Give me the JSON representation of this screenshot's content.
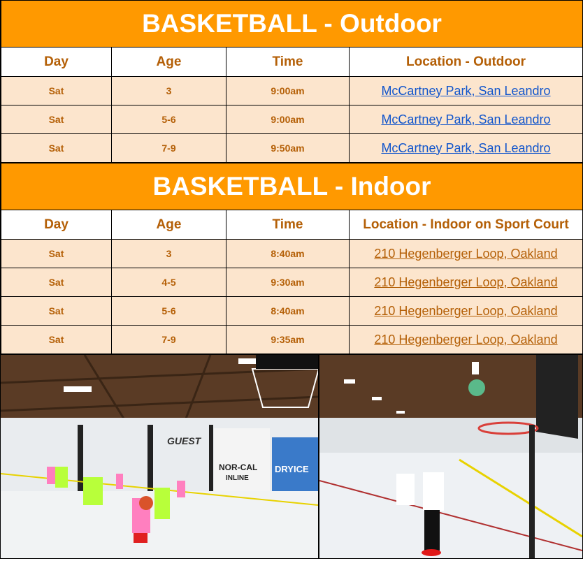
{
  "outdoor": {
    "title": "BASKETBALL - Outdoor",
    "headers": [
      "Day",
      "Age",
      "Time",
      "Location - Outdoor"
    ],
    "rows": [
      {
        "day": "Sat",
        "age": "3",
        "time": "9:00am",
        "location": "McCartney Park, San Leandro"
      },
      {
        "day": "Sat",
        "age": "5-6",
        "time": "9:00am",
        "location": "McCartney Park, San Leandro"
      },
      {
        "day": "Sat",
        "age": "7-9",
        "time": "9:50am",
        "location": "McCartney Park, San Leandro"
      }
    ]
  },
  "indoor": {
    "title": "BASKETBALL - Indoor",
    "headers": [
      "Day",
      "Age",
      "Time",
      "Location - Indoor on Sport Court"
    ],
    "rows": [
      {
        "day": "Sat",
        "age": "3",
        "time": "8:40am",
        "location": "210 Hegenberger Loop, Oakland"
      },
      {
        "day": "Sat",
        "age": "4-5",
        "time": "9:30am",
        "location": "210 Hegenberger Loop, Oakland"
      },
      {
        "day": "Sat",
        "age": "5-6",
        "time": "8:40am",
        "location": "210 Hegenberger Loop, Oakland"
      },
      {
        "day": "Sat",
        "age": "7-9",
        "time": "9:35am",
        "location": "210 Hegenberger Loop, Oakland"
      }
    ]
  },
  "photos": {
    "left_signage": [
      "GUEST",
      "NOR-CAL",
      "INLINE",
      "DRYICE"
    ]
  },
  "colors": {
    "title_bg": "#ff9900",
    "row_bg": "#fce5cd",
    "text": "#b45f06",
    "link_outdoor": "#1155cc"
  }
}
